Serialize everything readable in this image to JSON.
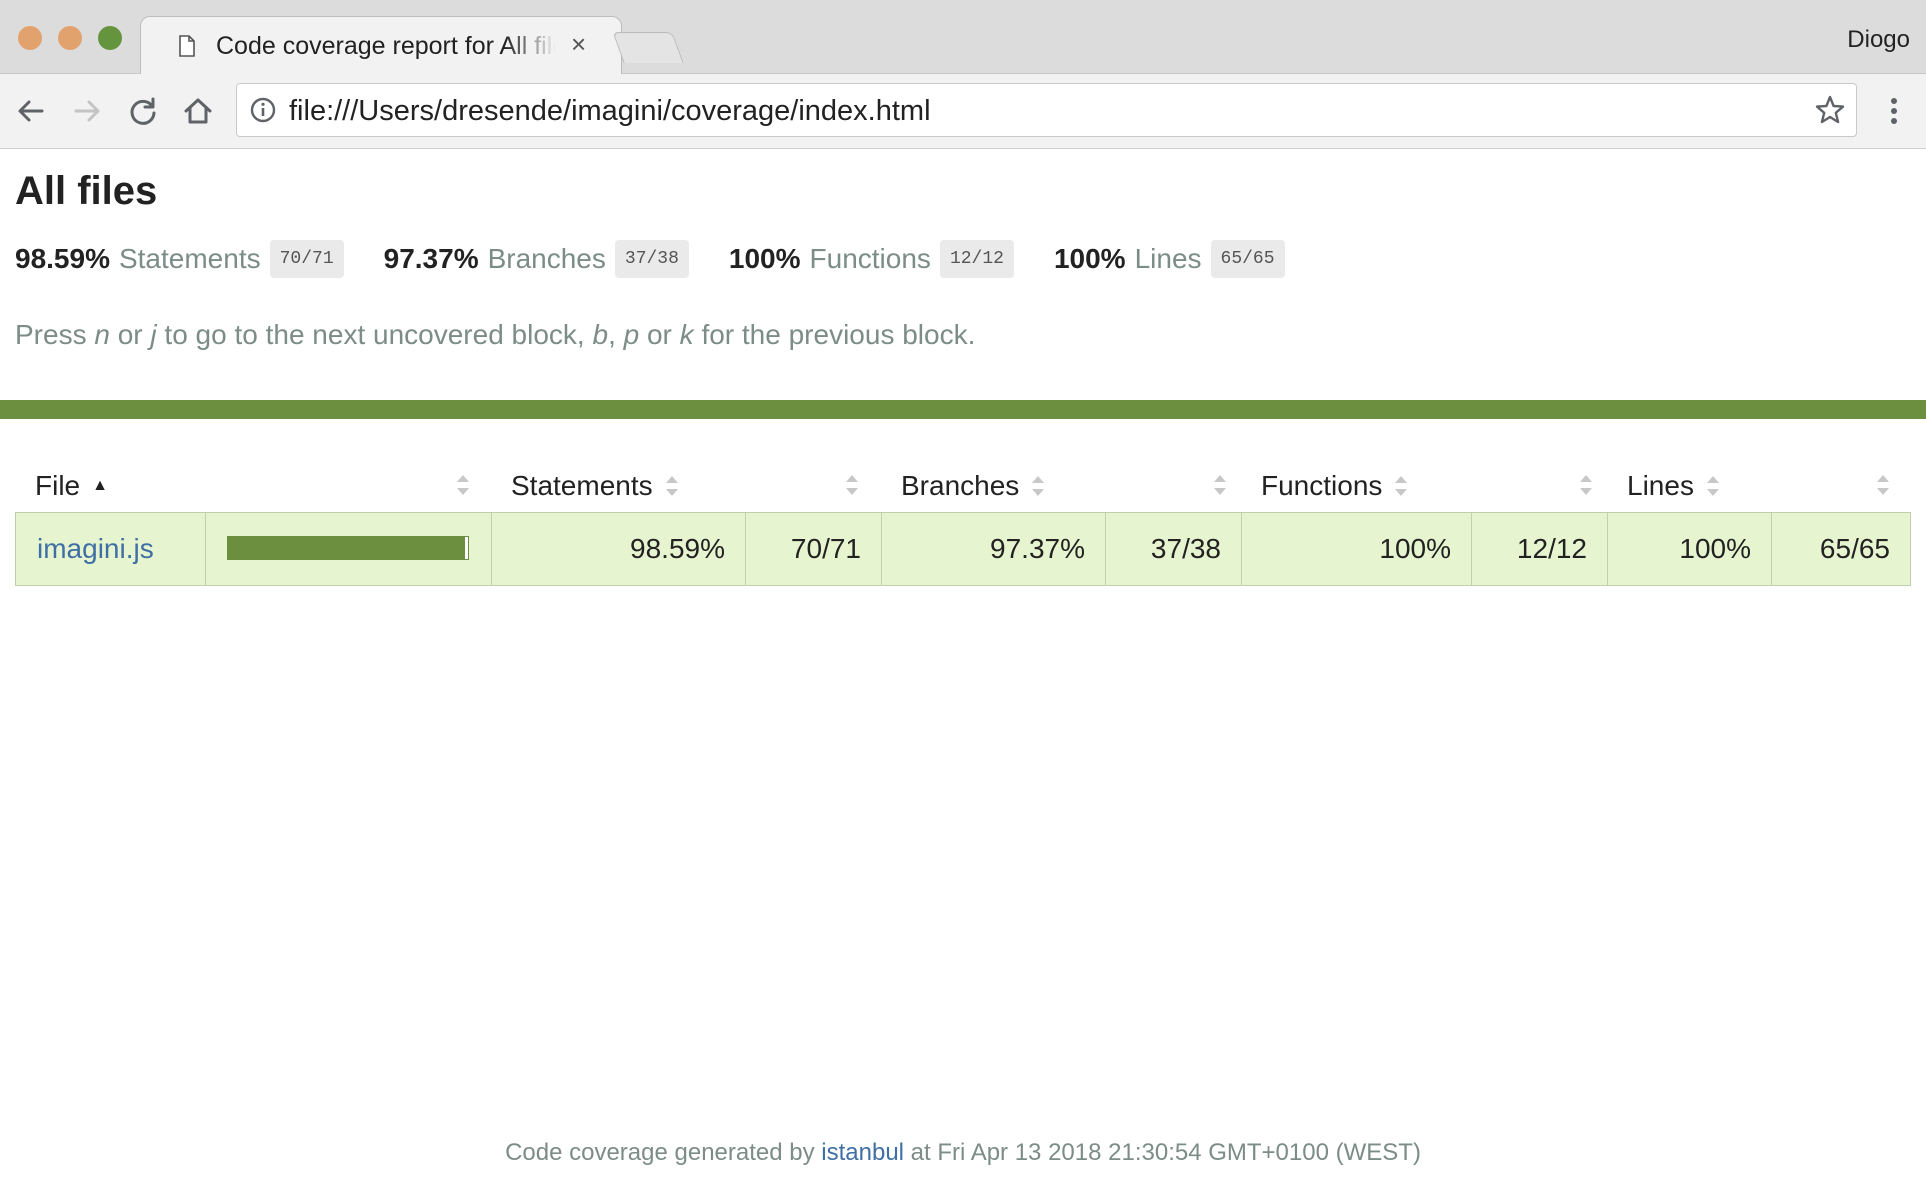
{
  "browser": {
    "tab": {
      "title": "Code coverage report for All files",
      "close_glyph": "×"
    },
    "profile": "Diogo",
    "url": "file:///Users/dresende/imagini/coverage/index.html",
    "icons": [
      "back-arrow-icon",
      "forward-arrow-icon",
      "reload-icon",
      "home-icon",
      "info-icon",
      "star-icon",
      "menu-dots-icon",
      "document-icon"
    ]
  },
  "report": {
    "title": "All files",
    "summary": {
      "statements": {
        "pct": "98.59%",
        "label": "Statements",
        "fraction": "70/71"
      },
      "branches": {
        "pct": "97.37%",
        "label": "Branches",
        "fraction": "37/38"
      },
      "functions": {
        "pct": "100%",
        "label": "Functions",
        "fraction": "12/12"
      },
      "lines": {
        "pct": "100%",
        "label": "Lines",
        "fraction": "65/65"
      }
    },
    "hint": {
      "p1": "Press ",
      "k1": "n",
      "p2": " or ",
      "k2": "j",
      "p3": " to go to the next uncovered block, ",
      "k3": "b",
      "p4": ", ",
      "k4": "p",
      "p5": " or ",
      "k5": "k",
      "p6": " for the previous block."
    },
    "status_color": "#6b8f3e",
    "table": {
      "headers": {
        "file": "File",
        "statements": "Statements",
        "branches": "Branches",
        "functions": "Functions",
        "lines": "Lines"
      },
      "sort_indicator": "▲",
      "rows": [
        {
          "file": "imagini.js",
          "coverage_fraction": 0.9859,
          "statements_pct": "98.59%",
          "statements_frac": "70/71",
          "branches_pct": "97.37%",
          "branches_frac": "37/38",
          "functions_pct": "100%",
          "functions_frac": "12/12",
          "lines_pct": "100%",
          "lines_frac": "65/65"
        }
      ],
      "row_color": "#e6f5d0"
    },
    "footer": {
      "prefix": "Code coverage generated by ",
      "link": "istanbul",
      "suffix": " at Fri Apr 13 2018 21:30:54 GMT+0100 (WEST)"
    }
  }
}
